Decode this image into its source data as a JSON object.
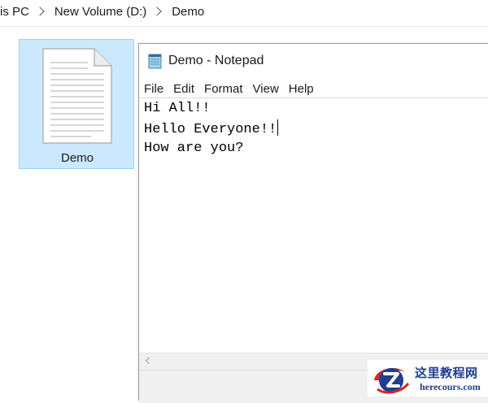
{
  "breadcrumb": {
    "items": [
      "is PC",
      "New Volume (D:)",
      "Demo"
    ]
  },
  "explorer": {
    "file_tile": {
      "label": "Demo",
      "icon": "text-document-icon"
    }
  },
  "notepad": {
    "title": "Demo - Notepad",
    "app_icon": "notepad-icon",
    "menu": [
      "File",
      "Edit",
      "Format",
      "View",
      "Help"
    ],
    "lines": [
      "Hi All!!",
      "Hello Everyone!!",
      "How are you?"
    ],
    "caret_line": 2
  },
  "watermark": {
    "title": "这里教程网",
    "url": "herecours.com"
  },
  "colors": {
    "selection_fill": "#cce8ff",
    "selection_border": "#99d1ff",
    "watermark_blue": "#1f3f8f",
    "watermark_red": "#d92626"
  }
}
